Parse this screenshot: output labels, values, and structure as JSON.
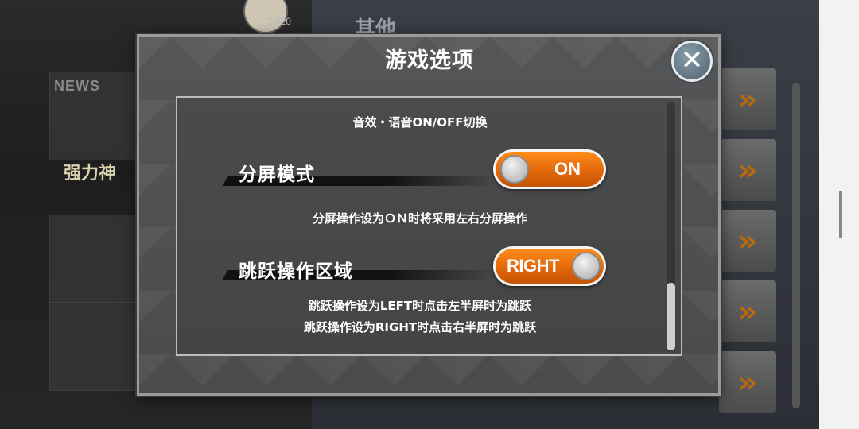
{
  "background": {
    "news_label": "NEWS",
    "banner_text": "强力神",
    "avatar_count": "20/20",
    "right_title": "其他",
    "arrow_glyph": "»"
  },
  "dialog": {
    "title": "游戏选项",
    "close_glyph": "✕",
    "sound_caption": "音效・语音ON/OFF切换",
    "options": [
      {
        "label": "分屏模式",
        "toggle_text": "ON",
        "toggle_state": "on",
        "description": [
          "分屏操作设为ＯＮ时将采用左右分屏操作"
        ]
      },
      {
        "label": "跳跃操作区域",
        "toggle_text": "RIGHT",
        "toggle_state": "right",
        "description": [
          "跳跃操作设为LEFT时点击左半屏时为跳跃",
          "跳跃操作设为RIGHT时点击右半屏时为跳跃"
        ]
      }
    ]
  },
  "colors": {
    "toggle_orange": "#e0650a",
    "arrow_orange": "#b66a10",
    "dialog_bg": "#4a4b4c"
  },
  "icons": {
    "close": "close-icon",
    "arrow": "double-chevron-right-icon"
  }
}
